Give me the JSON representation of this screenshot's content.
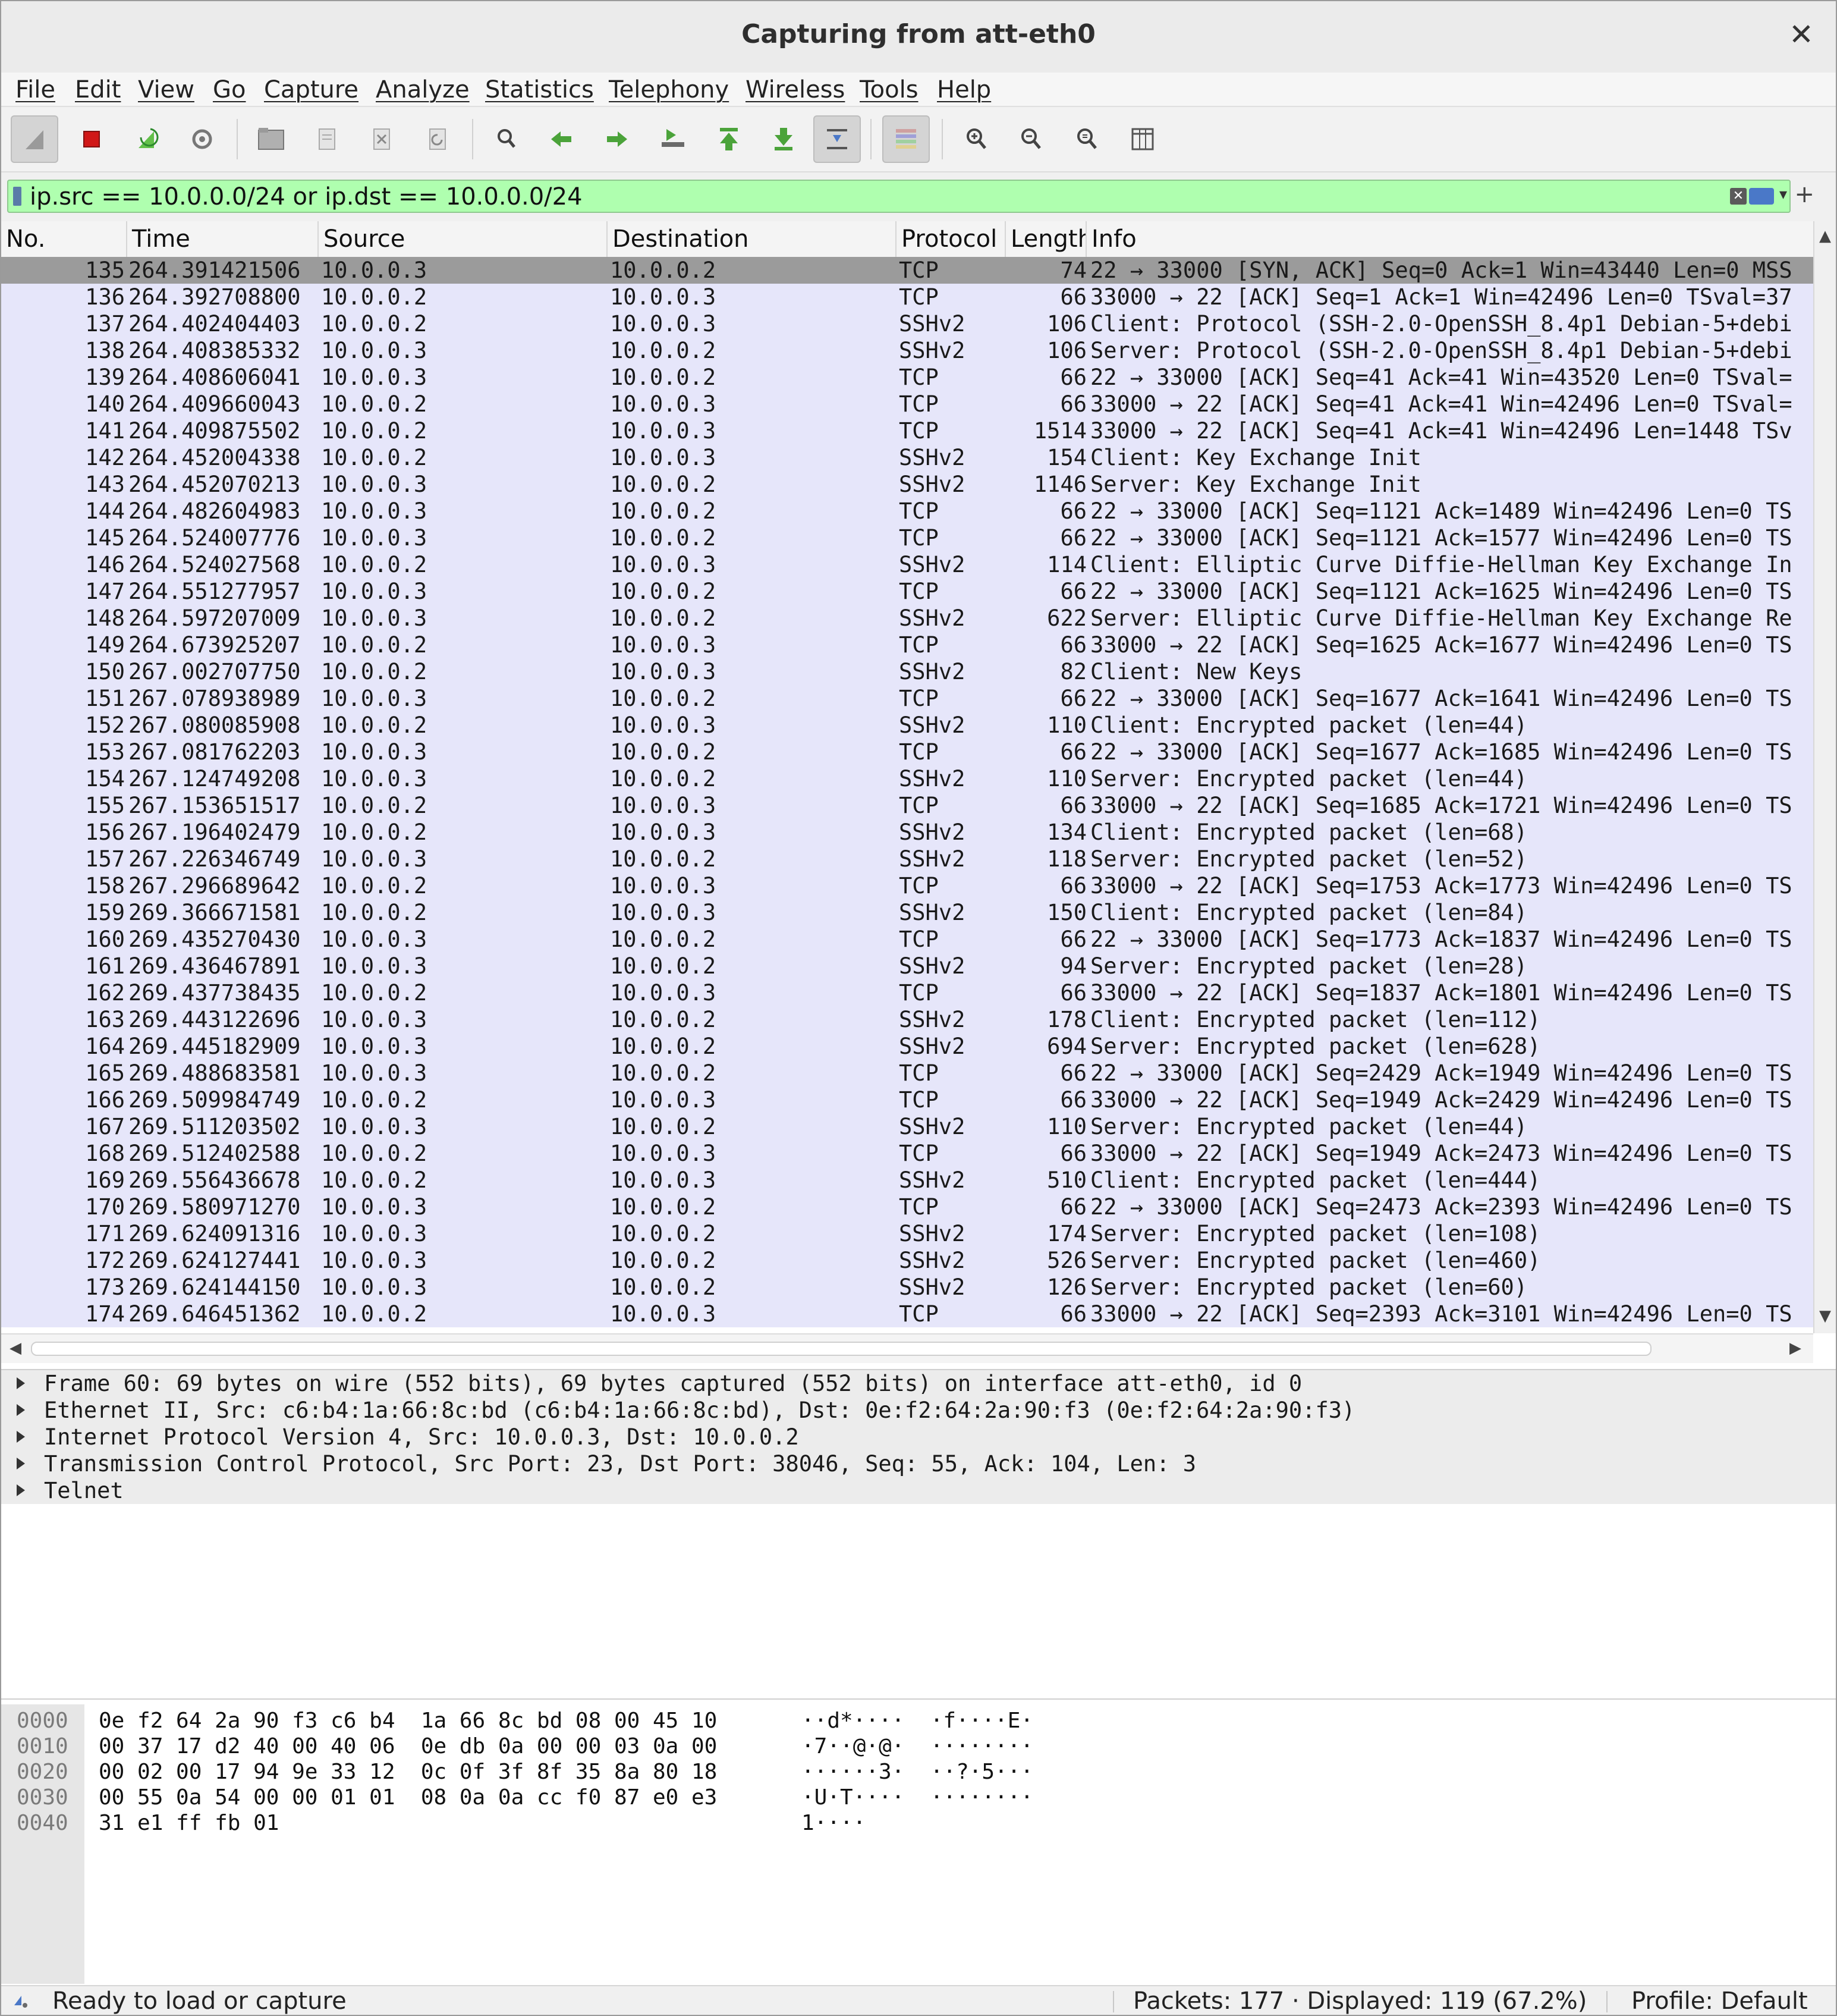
{
  "window": {
    "title": "Capturing from att-eth0",
    "close": "✕"
  },
  "menu": [
    "File",
    "Edit",
    "View",
    "Go",
    "Capture",
    "Analyze",
    "Statistics",
    "Telephony",
    "Wireless",
    "Tools",
    "Help"
  ],
  "filter": {
    "text": "ip.src == 10.0.0.0/24 or ip.dst == 10.0.0.0/24",
    "bg_color": "#afffaf"
  },
  "packet_list": {
    "headers": {
      "no": "No.",
      "time": "Time",
      "src": "Source",
      "dst": "Destination",
      "proto": "Protocol",
      "len": "Length",
      "info": "Info"
    },
    "row_color": "#e6e6fa",
    "selected_color": "#9b9b9b",
    "rows": [
      {
        "no": "135",
        "time": "264.391421506",
        "src": "10.0.0.3",
        "dst": "10.0.0.2",
        "proto": "TCP",
        "len": "74",
        "info": "22 → 33000 [SYN, ACK] Seq=0 Ack=1 Win=43440 Len=0 MSS"
      },
      {
        "no": "136",
        "time": "264.392708800",
        "src": "10.0.0.2",
        "dst": "10.0.0.3",
        "proto": "TCP",
        "len": "66",
        "info": "33000 → 22 [ACK] Seq=1 Ack=1 Win=42496 Len=0 TSval=37"
      },
      {
        "no": "137",
        "time": "264.402404403",
        "src": "10.0.0.2",
        "dst": "10.0.0.3",
        "proto": "SSHv2",
        "len": "106",
        "info": "Client: Protocol (SSH-2.0-OpenSSH_8.4p1 Debian-5+debi"
      },
      {
        "no": "138",
        "time": "264.408385332",
        "src": "10.0.0.3",
        "dst": "10.0.0.2",
        "proto": "SSHv2",
        "len": "106",
        "info": "Server: Protocol (SSH-2.0-OpenSSH_8.4p1 Debian-5+debi"
      },
      {
        "no": "139",
        "time": "264.408606041",
        "src": "10.0.0.3",
        "dst": "10.0.0.2",
        "proto": "TCP",
        "len": "66",
        "info": "22 → 33000 [ACK] Seq=41 Ack=41 Win=43520 Len=0 TSval="
      },
      {
        "no": "140",
        "time": "264.409660043",
        "src": "10.0.0.2",
        "dst": "10.0.0.3",
        "proto": "TCP",
        "len": "66",
        "info": "33000 → 22 [ACK] Seq=41 Ack=41 Win=42496 Len=0 TSval="
      },
      {
        "no": "141",
        "time": "264.409875502",
        "src": "10.0.0.2",
        "dst": "10.0.0.3",
        "proto": "TCP",
        "len": "1514",
        "info": "33000 → 22 [ACK] Seq=41 Ack=41 Win=42496 Len=1448 TSv"
      },
      {
        "no": "142",
        "time": "264.452004338",
        "src": "10.0.0.2",
        "dst": "10.0.0.3",
        "proto": "SSHv2",
        "len": "154",
        "info": "Client: Key Exchange Init"
      },
      {
        "no": "143",
        "time": "264.452070213",
        "src": "10.0.0.3",
        "dst": "10.0.0.2",
        "proto": "SSHv2",
        "len": "1146",
        "info": "Server: Key Exchange Init"
      },
      {
        "no": "144",
        "time": "264.482604983",
        "src": "10.0.0.3",
        "dst": "10.0.0.2",
        "proto": "TCP",
        "len": "66",
        "info": "22 → 33000 [ACK] Seq=1121 Ack=1489 Win=42496 Len=0 TS"
      },
      {
        "no": "145",
        "time": "264.524007776",
        "src": "10.0.0.3",
        "dst": "10.0.0.2",
        "proto": "TCP",
        "len": "66",
        "info": "22 → 33000 [ACK] Seq=1121 Ack=1577 Win=42496 Len=0 TS"
      },
      {
        "no": "146",
        "time": "264.524027568",
        "src": "10.0.0.2",
        "dst": "10.0.0.3",
        "proto": "SSHv2",
        "len": "114",
        "info": "Client: Elliptic Curve Diffie-Hellman Key Exchange In"
      },
      {
        "no": "147",
        "time": "264.551277957",
        "src": "10.0.0.3",
        "dst": "10.0.0.2",
        "proto": "TCP",
        "len": "66",
        "info": "22 → 33000 [ACK] Seq=1121 Ack=1625 Win=42496 Len=0 TS"
      },
      {
        "no": "148",
        "time": "264.597207009",
        "src": "10.0.0.3",
        "dst": "10.0.0.2",
        "proto": "SSHv2",
        "len": "622",
        "info": "Server: Elliptic Curve Diffie-Hellman Key Exchange Re"
      },
      {
        "no": "149",
        "time": "264.673925207",
        "src": "10.0.0.2",
        "dst": "10.0.0.3",
        "proto": "TCP",
        "len": "66",
        "info": "33000 → 22 [ACK] Seq=1625 Ack=1677 Win=42496 Len=0 TS"
      },
      {
        "no": "150",
        "time": "267.002707750",
        "src": "10.0.0.2",
        "dst": "10.0.0.3",
        "proto": "SSHv2",
        "len": "82",
        "info": "Client: New Keys"
      },
      {
        "no": "151",
        "time": "267.078938989",
        "src": "10.0.0.3",
        "dst": "10.0.0.2",
        "proto": "TCP",
        "len": "66",
        "info": "22 → 33000 [ACK] Seq=1677 Ack=1641 Win=42496 Len=0 TS"
      },
      {
        "no": "152",
        "time": "267.080085908",
        "src": "10.0.0.2",
        "dst": "10.0.0.3",
        "proto": "SSHv2",
        "len": "110",
        "info": "Client: Encrypted packet (len=44)"
      },
      {
        "no": "153",
        "time": "267.081762203",
        "src": "10.0.0.3",
        "dst": "10.0.0.2",
        "proto": "TCP",
        "len": "66",
        "info": "22 → 33000 [ACK] Seq=1677 Ack=1685 Win=42496 Len=0 TS"
      },
      {
        "no": "154",
        "time": "267.124749208",
        "src": "10.0.0.3",
        "dst": "10.0.0.2",
        "proto": "SSHv2",
        "len": "110",
        "info": "Server: Encrypted packet (len=44)"
      },
      {
        "no": "155",
        "time": "267.153651517",
        "src": "10.0.0.2",
        "dst": "10.0.0.3",
        "proto": "TCP",
        "len": "66",
        "info": "33000 → 22 [ACK] Seq=1685 Ack=1721 Win=42496 Len=0 TS"
      },
      {
        "no": "156",
        "time": "267.196402479",
        "src": "10.0.0.2",
        "dst": "10.0.0.3",
        "proto": "SSHv2",
        "len": "134",
        "info": "Client: Encrypted packet (len=68)"
      },
      {
        "no": "157",
        "time": "267.226346749",
        "src": "10.0.0.3",
        "dst": "10.0.0.2",
        "proto": "SSHv2",
        "len": "118",
        "info": "Server: Encrypted packet (len=52)"
      },
      {
        "no": "158",
        "time": "267.296689642",
        "src": "10.0.0.2",
        "dst": "10.0.0.3",
        "proto": "TCP",
        "len": "66",
        "info": "33000 → 22 [ACK] Seq=1753 Ack=1773 Win=42496 Len=0 TS"
      },
      {
        "no": "159",
        "time": "269.366671581",
        "src": "10.0.0.2",
        "dst": "10.0.0.3",
        "proto": "SSHv2",
        "len": "150",
        "info": "Client: Encrypted packet (len=84)"
      },
      {
        "no": "160",
        "time": "269.435270430",
        "src": "10.0.0.3",
        "dst": "10.0.0.2",
        "proto": "TCP",
        "len": "66",
        "info": "22 → 33000 [ACK] Seq=1773 Ack=1837 Win=42496 Len=0 TS"
      },
      {
        "no": "161",
        "time": "269.436467891",
        "src": "10.0.0.3",
        "dst": "10.0.0.2",
        "proto": "SSHv2",
        "len": "94",
        "info": "Server: Encrypted packet (len=28)"
      },
      {
        "no": "162",
        "time": "269.437738435",
        "src": "10.0.0.2",
        "dst": "10.0.0.3",
        "proto": "TCP",
        "len": "66",
        "info": "33000 → 22 [ACK] Seq=1837 Ack=1801 Win=42496 Len=0 TS"
      },
      {
        "no": "163",
        "time": "269.443122696",
        "src": "10.0.0.3",
        "dst": "10.0.0.2",
        "proto": "SSHv2",
        "len": "178",
        "info": "Client: Encrypted packet (len=112)"
      },
      {
        "no": "164",
        "time": "269.445182909",
        "src": "10.0.0.3",
        "dst": "10.0.0.2",
        "proto": "SSHv2",
        "len": "694",
        "info": "Server: Encrypted packet (len=628)"
      },
      {
        "no": "165",
        "time": "269.488683581",
        "src": "10.0.0.3",
        "dst": "10.0.0.2",
        "proto": "TCP",
        "len": "66",
        "info": "22 → 33000 [ACK] Seq=2429 Ack=1949 Win=42496 Len=0 TS"
      },
      {
        "no": "166",
        "time": "269.509984749",
        "src": "10.0.0.2",
        "dst": "10.0.0.3",
        "proto": "TCP",
        "len": "66",
        "info": "33000 → 22 [ACK] Seq=1949 Ack=2429 Win=42496 Len=0 TS"
      },
      {
        "no": "167",
        "time": "269.511203502",
        "src": "10.0.0.3",
        "dst": "10.0.0.2",
        "proto": "SSHv2",
        "len": "110",
        "info": "Server: Encrypted packet (len=44)"
      },
      {
        "no": "168",
        "time": "269.512402588",
        "src": "10.0.0.2",
        "dst": "10.0.0.3",
        "proto": "TCP",
        "len": "66",
        "info": "33000 → 22 [ACK] Seq=1949 Ack=2473 Win=42496 Len=0 TS"
      },
      {
        "no": "169",
        "time": "269.556436678",
        "src": "10.0.0.2",
        "dst": "10.0.0.3",
        "proto": "SSHv2",
        "len": "510",
        "info": "Client: Encrypted packet (len=444)"
      },
      {
        "no": "170",
        "time": "269.580971270",
        "src": "10.0.0.3",
        "dst": "10.0.0.2",
        "proto": "TCP",
        "len": "66",
        "info": "22 → 33000 [ACK] Seq=2473 Ack=2393 Win=42496 Len=0 TS"
      },
      {
        "no": "171",
        "time": "269.624091316",
        "src": "10.0.0.3",
        "dst": "10.0.0.2",
        "proto": "SSHv2",
        "len": "174",
        "info": "Server: Encrypted packet (len=108)"
      },
      {
        "no": "172",
        "time": "269.624127441",
        "src": "10.0.0.3",
        "dst": "10.0.0.2",
        "proto": "SSHv2",
        "len": "526",
        "info": "Server: Encrypted packet (len=460)"
      },
      {
        "no": "173",
        "time": "269.624144150",
        "src": "10.0.0.3",
        "dst": "10.0.0.2",
        "proto": "SSHv2",
        "len": "126",
        "info": "Server: Encrypted packet (len=60)"
      },
      {
        "no": "174",
        "time": "269.646451362",
        "src": "10.0.0.2",
        "dst": "10.0.0.3",
        "proto": "TCP",
        "len": "66",
        "info": "33000 → 22 [ACK] Seq=2393 Ack=3101 Win=42496 Len=0 TS"
      }
    ]
  },
  "details": [
    "Frame 60: 69 bytes on wire (552 bits), 69 bytes captured (552 bits) on interface att-eth0, id 0",
    "Ethernet II, Src: c6:b4:1a:66:8c:bd (c6:b4:1a:66:8c:bd), Dst: 0e:f2:64:2a:90:f3 (0e:f2:64:2a:90:f3)",
    "Internet Protocol Version 4, Src: 10.0.0.3, Dst: 10.0.0.2",
    "Transmission Control Protocol, Src Port: 23, Dst Port: 38046, Seq: 55, Ack: 104, Len: 3",
    "Telnet"
  ],
  "bytes": [
    {
      "off": "0000",
      "hex": "0e f2 64 2a 90 f3 c6 b4  1a 66 8c bd 08 00 45 10",
      "ascii": "··d*····  ·f····E·"
    },
    {
      "off": "0010",
      "hex": "00 37 17 d2 40 00 40 06  0e db 0a 00 00 03 0a 00",
      "ascii": "·7··@·@·  ········"
    },
    {
      "off": "0020",
      "hex": "00 02 00 17 94 9e 33 12  0c 0f 3f 8f 35 8a 80 18",
      "ascii": "······3·  ··?·5···"
    },
    {
      "off": "0030",
      "hex": "00 55 0a 54 00 00 01 01  08 0a 0a cc f0 87 e0 e3",
      "ascii": "·U·T····  ········"
    },
    {
      "off": "0040",
      "hex": "31 e1 ff fb 01",
      "ascii": "1····"
    }
  ],
  "status": {
    "message": "Ready to load or capture",
    "packets": "Packets: 177 · Displayed: 119 (67.2%)",
    "profile": "Profile: Default"
  }
}
